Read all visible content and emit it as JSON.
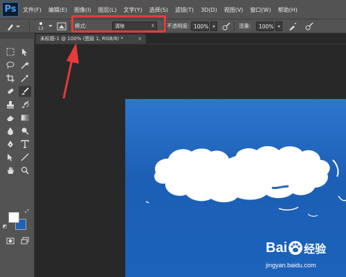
{
  "app": {
    "logo": "Ps"
  },
  "menu": [
    "文件(F)",
    "编辑(E)",
    "图像(I)",
    "图层(L)",
    "文字(Y)",
    "选择(S)",
    "滤镜(T)",
    "3D(D)",
    "视图(V)",
    "窗口(W)",
    "帮助(H)"
  ],
  "options": {
    "brush_size": "13",
    "mode_label": "模式:",
    "mode_value": "清除",
    "opacity_label": "不透明度:",
    "opacity_value": "100%",
    "flow_label": "流量:",
    "flow_value": "100%"
  },
  "document": {
    "tab_title": "未标题-1 @ 100% (图层 1, RGB/8) *",
    "close": "×"
  },
  "toolbox": {
    "foreground_color": "#ffffff",
    "background_color": "#1e63b4"
  },
  "watermark": {
    "logo_text": "Bai",
    "logo_text2": "经验",
    "url": "jingyan.baidu.com"
  },
  "colors": {
    "highlight": "#e83a3a",
    "canvas": "#1e63b4"
  }
}
